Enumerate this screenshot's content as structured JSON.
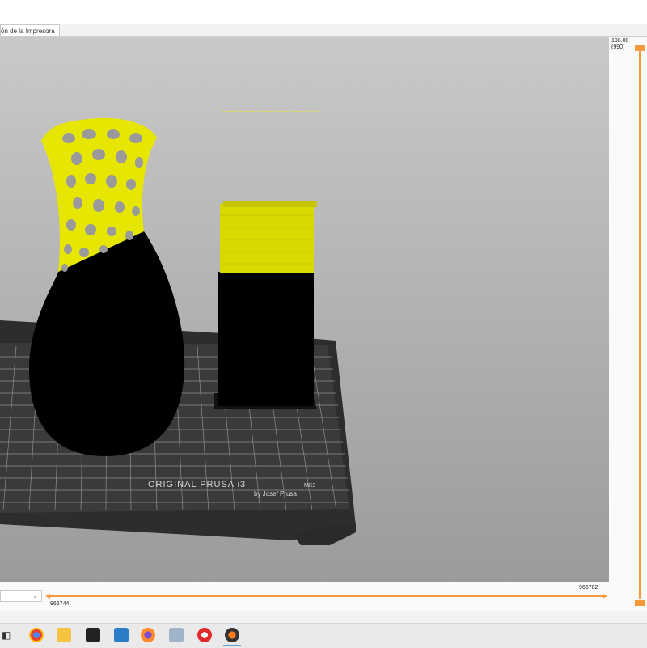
{
  "tab": {
    "label": "ón de la Impresora"
  },
  "viewport": {
    "bed_brand": "ORIGINAL PRUSA i3",
    "bed_model": "MK3",
    "bed_author": "by Josef Prusa"
  },
  "layer_slider": {
    "top_value": "198.00",
    "top_layer": "(990)"
  },
  "moves_slider": {
    "left_value": "966744",
    "right_value": "966782"
  },
  "taskbar": {
    "icons": [
      "task-view-icon",
      "chrome-icon",
      "file-explorer-icon",
      "store-icon",
      "mail-icon",
      "firefox-icon",
      "calculator-icon",
      "record-icon",
      "prusaslicer-icon"
    ]
  },
  "colors": {
    "accent": "#f59a3a",
    "filament_yellow": "#e6e600",
    "filament_black": "#000000"
  }
}
